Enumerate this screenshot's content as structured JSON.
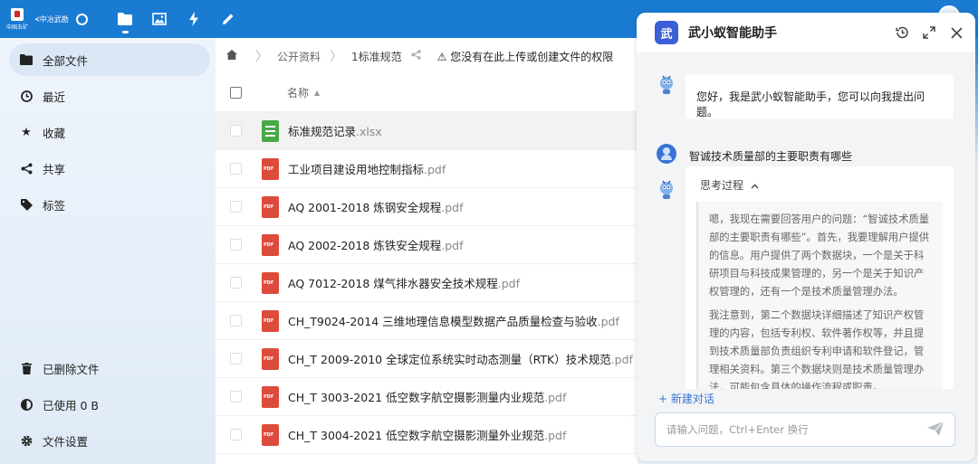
{
  "topbar": {
    "logo_text": "中国五矿",
    "brand_text": "ᗕ中冶武勘",
    "icons": [
      "files-icon",
      "photos-icon",
      "activity-icon",
      "notes-icon"
    ]
  },
  "sidebar": {
    "items": [
      {
        "label": "全部文件",
        "icon": "folder-icon"
      },
      {
        "label": "最近",
        "icon": "clock-icon"
      },
      {
        "label": "收藏",
        "icon": "star-icon"
      },
      {
        "label": "共享",
        "icon": "share-icon"
      },
      {
        "label": "标签",
        "icon": "tag-icon"
      }
    ],
    "bottom": [
      {
        "label": "已删除文件",
        "icon": "trash-icon"
      },
      {
        "label": "已使用 0 B",
        "icon": "quota-icon"
      },
      {
        "label": "文件设置",
        "icon": "gear-icon"
      }
    ]
  },
  "breadcrumb": {
    "items": [
      "公开资料",
      "1标准规范"
    ],
    "warning": "您没有在此上传或创建文件的权限"
  },
  "list": {
    "column_name": "名称",
    "files": [
      {
        "name": "标准规范记录",
        "ext": ".xlsx",
        "type": "xlsx"
      },
      {
        "name": "工业项目建设用地控制指标",
        "ext": ".pdf",
        "type": "pdf"
      },
      {
        "name": "AQ 2001-2018 炼钢安全规程",
        "ext": ".pdf",
        "type": "pdf"
      },
      {
        "name": "AQ 2002-2018 炼铁安全规程",
        "ext": ".pdf",
        "type": "pdf"
      },
      {
        "name": "AQ 7012-2018 煤气排水器安全技术规程",
        "ext": ".pdf",
        "type": "pdf"
      },
      {
        "name": "CH_T9024-2014 三维地理信息模型数据产品质量检查与验收",
        "ext": ".pdf",
        "type": "pdf"
      },
      {
        "name": "CH_T 2009-2010 全球定位系统实时动态测量（RTK）技术规范",
        "ext": ".pdf",
        "type": "pdf"
      },
      {
        "name": "CH_T 3003-2021 低空数字航空摄影测量内业规范",
        "ext": ".pdf",
        "type": "pdf"
      },
      {
        "name": "CH_T 3004-2021 低空数字航空摄影测量外业规范",
        "ext": ".pdf",
        "type": "pdf"
      }
    ]
  },
  "assistant": {
    "logo": "武",
    "title": "武小蚁智能助手",
    "greeting": "您好，我是武小蚁智能助手，您可以向我提出问题。",
    "user_question": "智诚技术质量部的主要职责有哪些",
    "thinking_label": "思考过程",
    "thinking_p1": "嗯，我现在需要回答用户的问题：“智诚技术质量部的主要职责有哪些”。首先，我要理解用户提供的信息。用户提供了两个数据块，一个是关于科研项目与科技成果管理的，另一个是关于知识产权管理的，还有一个是技术质量管理办法。",
    "thinking_p2": "我注意到，第二个数据块详细描述了知识产权管理的内容，包括专利权、软件著作权等，并且提到技术质量部负责组织专利申请和软件登记，管理相关资料。第三个数据块则是技术质量管理办法，可能包含具体的操作流程或职责。",
    "new_chat": "+ 新建对话",
    "input_placeholder": "请输入问题，Ctrl+Enter 换行"
  }
}
